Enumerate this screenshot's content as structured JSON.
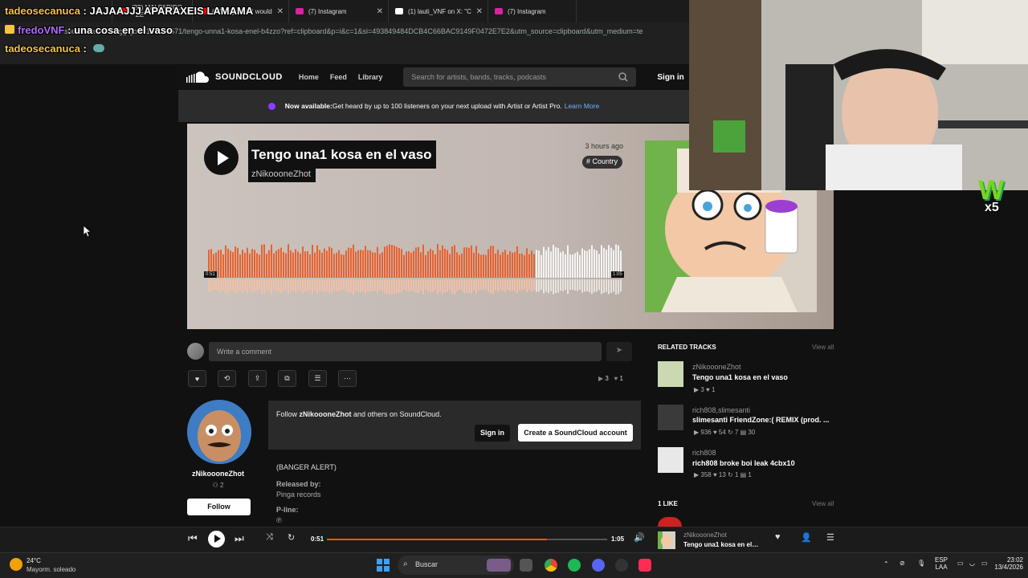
{
  "browser": {
    "tabs": [
      {
        "label": "ebay",
        "color": "#e53238"
      },
      {
        "label": "(29) MALPARIDO - ZE",
        "color": "#ff0000"
      },
      {
        "label": "(29) zayn like i would",
        "color": "#ff0000"
      },
      {
        "label": "(7) Instagram",
        "color": "#d6249f"
      },
      {
        "label": "(1) lauti_VNF on X: \"C",
        "color": "#ffffff"
      },
      {
        "label": "(7) Instagram",
        "color": "#d6249f"
      }
    ],
    "url": "soundcloud.com/gg-go-d-177264571/tengo-unna1-kosa-enel-b4zzo?ref=clipboard&p=i&c=1&si=493849484DCB4C66BAC9149F0472E7E2&utm_source=clipboard&utm_medium=te"
  },
  "chat": [
    {
      "user": "tadeosecanuca",
      "sep": " : ",
      "message": "JAJAAJJJ APARAXEIS LAMAMA"
    },
    {
      "user": "fredoVNF",
      "sep": " : ",
      "message": "una cosa en el vaso"
    },
    {
      "user": "tadeosecanuca",
      "sep": " : ",
      "message": ""
    }
  ],
  "header": {
    "logo": "SOUNDCLOUD",
    "nav": [
      "Home",
      "Feed",
      "Library"
    ],
    "search_placeholder": "Search for artists, bands, tracks, podcasts",
    "signin": "Sign in"
  },
  "banner": {
    "lead": "Now available:",
    "text": " Get heard by up to 100 listeners on your next upload with Artist or Artist Pro.",
    "link": "Learn More"
  },
  "track": {
    "title": "Tengo una1 kosa en el vaso",
    "artist": "zNikoooneZhot",
    "uploaded": "3 hours ago",
    "genre": "# Country",
    "current_time": "0:51",
    "duration": "1:05",
    "progress": 0.785
  },
  "comment": {
    "placeholder": "Write a comment"
  },
  "stats": {
    "plays": "3",
    "likes": "1"
  },
  "artist_panel": {
    "name": "zNikoooneZhot",
    "followers": "2",
    "follow_label": "Follow"
  },
  "follow_box": {
    "prefix": "Follow ",
    "artist": "zNikoooneZhot",
    "suffix": " and others on SoundCloud.",
    "signin": "Sign in",
    "create": "Create a SoundCloud account"
  },
  "description": {
    "line1": "(BANGER ALERT)",
    "released_by_label": "Released by:",
    "released_by": "Pinga records",
    "pline_label": "P-line:",
    "pline": "℗"
  },
  "sidebar": {
    "related_header": "RELATED TRACKS",
    "view_all": "View all",
    "related": [
      {
        "artist": "zNikoooneZhot",
        "title": "Tengo una1 kosa en el vaso",
        "stats": "▶ 3   ♥ 1",
        "color": "#c8d8b0"
      },
      {
        "artist": "rich808,slimesanti",
        "title": "slimesanti FriendZone:( REMIX (prod. ...",
        "stats": "▶ 936   ♥ 54   ↻ 7   ▤ 30",
        "color": "#3a3a3a"
      },
      {
        "artist": "rich808",
        "title": "rich808 broke boi leak 4cbx10",
        "stats": "▶ 358   ♥ 13   ↻ 1   ▤ 1",
        "color": "#e8e8e8"
      }
    ],
    "likes_header": "1 LIKE",
    "likes_view_all": "View all"
  },
  "player": {
    "current": "0:51",
    "duration": "1:05",
    "progress": 0.785,
    "artist": "zNikoooneZhot",
    "title": "Tengo una1 kosa en el v..."
  },
  "taskbar": {
    "temp": "24°C",
    "weather": "Mayorm. soleado",
    "search": "Buscar",
    "lang1": "ESP",
    "lang2": "LAA",
    "time": "23:02",
    "date": "13/4/2026"
  },
  "overlay_badge": "x5",
  "colors": {
    "accent": "#ff5500",
    "played": "#e8612e",
    "unplayed": "#f4f4f4"
  }
}
